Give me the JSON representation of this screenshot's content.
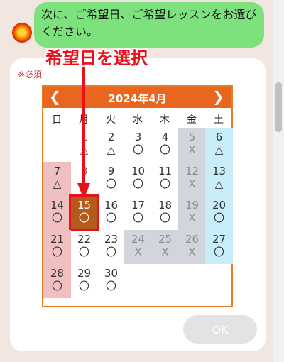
{
  "chat": {
    "message": "次に、ご希望日、ご希望レッスンをお選びください。"
  },
  "annotation": {
    "text": "希望日を選択"
  },
  "form": {
    "required_label": "※必須"
  },
  "calendar": {
    "month_title": "2024年4月",
    "prev_icon": "chevron-left-icon",
    "next_icon": "chevron-right-icon",
    "weekdays": [
      "日",
      "月",
      "火",
      "水",
      "木",
      "金",
      "土"
    ],
    "selected_day": "15",
    "days": [
      {
        "day": "1",
        "mark": "△",
        "col": 1,
        "row": 0,
        "state": "past"
      },
      {
        "day": "2",
        "mark": "△",
        "col": 2,
        "row": 0,
        "state": "normal"
      },
      {
        "day": "3",
        "mark": "〇",
        "col": 3,
        "row": 0,
        "state": "normal"
      },
      {
        "day": "4",
        "mark": "〇",
        "col": 4,
        "row": 0,
        "state": "normal"
      },
      {
        "day": "5",
        "mark": "X",
        "col": 5,
        "row": 0,
        "state": "gray"
      },
      {
        "day": "6",
        "mark": "△",
        "col": 6,
        "row": 0,
        "state": "sat"
      },
      {
        "day": "7",
        "mark": "△",
        "col": 0,
        "row": 1,
        "state": "sun"
      },
      {
        "day": "8",
        "mark": "",
        "col": 1,
        "row": 1,
        "state": "past"
      },
      {
        "day": "9",
        "mark": "〇",
        "col": 2,
        "row": 1,
        "state": "normal"
      },
      {
        "day": "10",
        "mark": "〇",
        "col": 3,
        "row": 1,
        "state": "normal"
      },
      {
        "day": "11",
        "mark": "〇",
        "col": 4,
        "row": 1,
        "state": "normal"
      },
      {
        "day": "12",
        "mark": "X",
        "col": 5,
        "row": 1,
        "state": "gray"
      },
      {
        "day": "13",
        "mark": "△",
        "col": 6,
        "row": 1,
        "state": "sat"
      },
      {
        "day": "14",
        "mark": "〇",
        "col": 0,
        "row": 2,
        "state": "sun"
      },
      {
        "day": "15",
        "mark": "〇",
        "col": 1,
        "row": 2,
        "state": "selected"
      },
      {
        "day": "16",
        "mark": "〇",
        "col": 2,
        "row": 2,
        "state": "normal"
      },
      {
        "day": "17",
        "mark": "〇",
        "col": 3,
        "row": 2,
        "state": "normal"
      },
      {
        "day": "18",
        "mark": "〇",
        "col": 4,
        "row": 2,
        "state": "normal"
      },
      {
        "day": "19",
        "mark": "X",
        "col": 5,
        "row": 2,
        "state": "gray"
      },
      {
        "day": "20",
        "mark": "〇",
        "col": 6,
        "row": 2,
        "state": "sat"
      },
      {
        "day": "21",
        "mark": "〇",
        "col": 0,
        "row": 3,
        "state": "sun"
      },
      {
        "day": "22",
        "mark": "〇",
        "col": 1,
        "row": 3,
        "state": "normal"
      },
      {
        "day": "23",
        "mark": "〇",
        "col": 2,
        "row": 3,
        "state": "normal"
      },
      {
        "day": "24",
        "mark": "X",
        "col": 3,
        "row": 3,
        "state": "gray"
      },
      {
        "day": "25",
        "mark": "X",
        "col": 4,
        "row": 3,
        "state": "gray"
      },
      {
        "day": "26",
        "mark": "X",
        "col": 5,
        "row": 3,
        "state": "gray"
      },
      {
        "day": "27",
        "mark": "〇",
        "col": 6,
        "row": 3,
        "state": "sat"
      },
      {
        "day": "28",
        "mark": "〇",
        "col": 0,
        "row": 4,
        "state": "sun"
      },
      {
        "day": "29",
        "mark": "〇",
        "col": 1,
        "row": 4,
        "state": "normal"
      },
      {
        "day": "30",
        "mark": "〇",
        "col": 2,
        "row": 4,
        "state": "normal"
      }
    ]
  },
  "actions": {
    "ok_label": "OK"
  },
  "colors": {
    "header": "#e8661e",
    "sunday": "#f0bfc0",
    "saturday": "#c8ecf8",
    "unavailable": "#d3d5dc",
    "selected": "#b35a1c",
    "highlight": "#e8101c",
    "chat_bubble": "#7de27d"
  }
}
